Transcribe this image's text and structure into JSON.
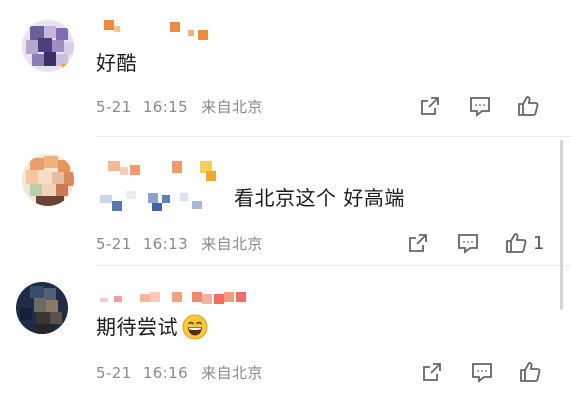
{
  "comments": [
    {
      "text": "好酷",
      "date": "5-21",
      "time": "16:15",
      "location": "来自北京",
      "like_count": ""
    },
    {
      "text": "看北京这个  好高端",
      "date": "5-21",
      "time": "16:13",
      "location": "来自北京",
      "like_count": "1"
    },
    {
      "text": "期待尝试",
      "date": "5-21",
      "time": "16:16",
      "location": "来自北京",
      "like_count": ""
    }
  ],
  "icons": {
    "share": "share-icon",
    "comment": "comment-icon",
    "like": "thumbs-up-icon",
    "emoji": "grinning-emoji-icon"
  },
  "colors": {
    "meta_text": "#8a8a8a",
    "divider": "#ececec",
    "icon": "#666666"
  }
}
